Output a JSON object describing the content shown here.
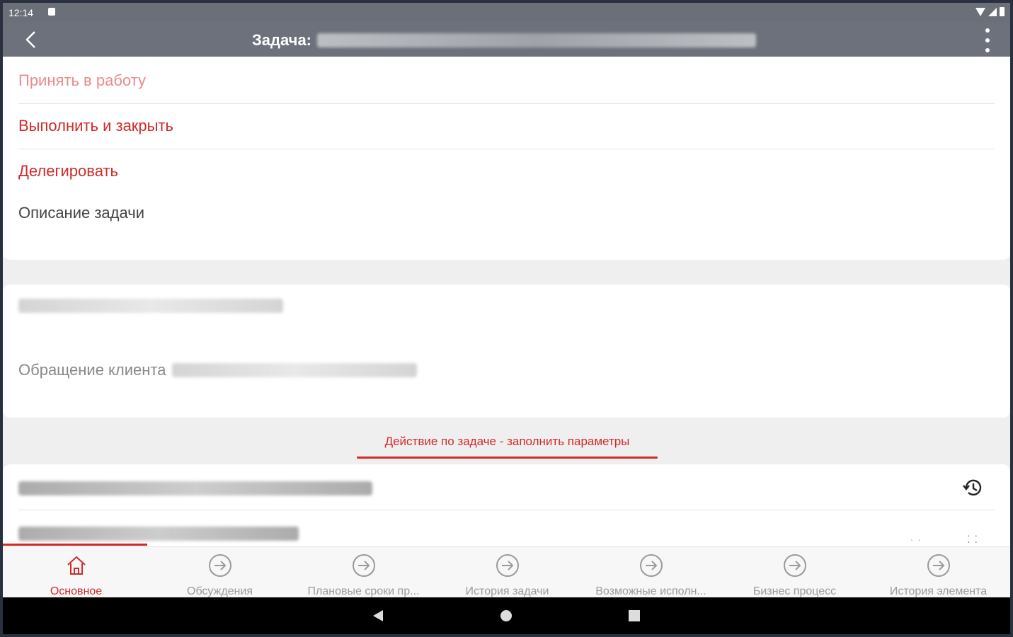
{
  "status_bar": {
    "time": "12:14"
  },
  "app_bar": {
    "title_label": "Задача:"
  },
  "actions": {
    "accept": "Принять в работу",
    "complete": "Выполнить и закрыть",
    "delegate": "Делегировать",
    "description": "Описание задачи"
  },
  "details": {
    "appeal_label": "Обращение клиента"
  },
  "section_tab": {
    "label": "Действие по задаче - заполнить параметры"
  },
  "bottom_nav": {
    "items": [
      {
        "label": "Основное",
        "icon": "home-icon"
      },
      {
        "label": "Обсуждения",
        "icon": "arrow-circle-icon"
      },
      {
        "label": "Плановые сроки пр...",
        "icon": "arrow-circle-icon"
      },
      {
        "label": "История задачи",
        "icon": "arrow-circle-icon"
      },
      {
        "label": "Возможные исполн...",
        "icon": "arrow-circle-icon"
      },
      {
        "label": "Бизнес процесс",
        "icon": "arrow-circle-icon"
      },
      {
        "label": "История элемента",
        "icon": "arrow-circle-icon"
      }
    ]
  },
  "colors": {
    "accent": "#d22a2a",
    "appbar": "#6c717b",
    "inactive": "#9a9a9a"
  }
}
